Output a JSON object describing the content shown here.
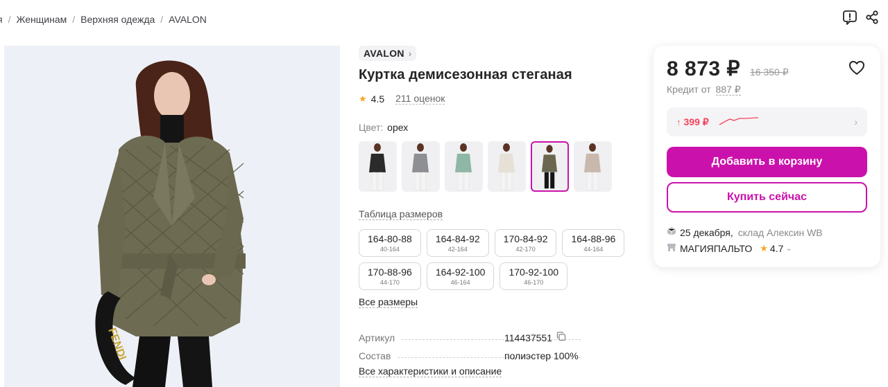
{
  "breadcrumbs": {
    "fragment": "я",
    "items": [
      "Женщинам",
      "Верхняя одежда",
      "AVALON"
    ],
    "separator": "/"
  },
  "top_icons": [
    "report-icon",
    "share-icon"
  ],
  "product": {
    "brand": "AVALON",
    "title": "Куртка демисезонная стеганая",
    "rating": "4.5",
    "reviews": "211 оценок",
    "color_label": "Цвет:",
    "color_value": "орех",
    "swatch_colors": [
      "#2b2b2b",
      "#8e8f93",
      "#8fb7a8",
      "#e6e0d6",
      "#6a6650",
      "#c9b9ad"
    ],
    "selected_swatch": 4,
    "size_table_link": "Таблица размеров",
    "sizes": [
      {
        "main": "164-80-88",
        "sub": "40-164"
      },
      {
        "main": "164-84-92",
        "sub": "42-164"
      },
      {
        "main": "170-84-92",
        "sub": "42-170"
      },
      {
        "main": "164-88-96",
        "sub": "44-164"
      },
      {
        "main": "170-88-96",
        "sub": "44-170"
      },
      {
        "main": "164-92-100",
        "sub": "46-164"
      },
      {
        "main": "170-92-100",
        "sub": "46-170"
      }
    ],
    "all_sizes": "Все размеры",
    "specs": [
      {
        "label": "Артикул",
        "value": "114437551"
      },
      {
        "label": "Состав",
        "value": "полиэстер 100%"
      }
    ],
    "all_specs": "Все характеристики и описание"
  },
  "buy_panel": {
    "price": "8 873 ₽",
    "old_price": "16 350 ₽",
    "credit_label": "Кредит от",
    "credit_amount": "887 ₽",
    "price_history": "399 ₽",
    "add_to_cart": "Добавить в корзину",
    "buy_now": "Купить сейчас",
    "delivery_date": "25 декабря,",
    "warehouse": "склад Алексин WB",
    "seller": "МАГИЯПАЛЬТО",
    "seller_rating": "4.7"
  },
  "colors": {
    "accent": "#cb11ab",
    "price_up": "#f4435b",
    "star": "#f5a623"
  }
}
